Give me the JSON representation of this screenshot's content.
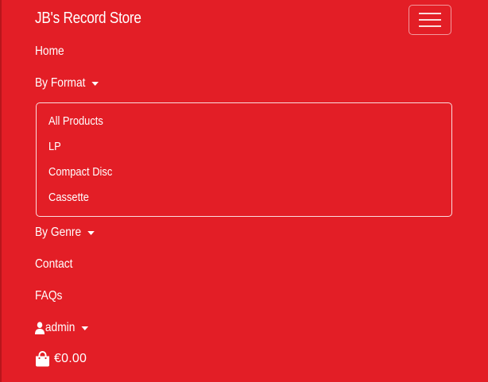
{
  "theme": {
    "background": "#e31e26",
    "text": "#ffffff"
  },
  "navbar": {
    "brand": "JB's Record Store",
    "toggler_icon": "hamburger-icon"
  },
  "nav": {
    "home": "Home",
    "by_format": {
      "label": "By Format",
      "expanded": true,
      "items": [
        "All Products",
        "LP",
        "Compact Disc",
        "Cassette"
      ]
    },
    "by_genre": {
      "label": "By Genre"
    },
    "contact": "Contact",
    "faqs": "FAQs",
    "account": {
      "label": "admin",
      "icon": "user-icon"
    },
    "cart": {
      "icon": "shopping-bag-icon",
      "total": "€0.00"
    }
  }
}
